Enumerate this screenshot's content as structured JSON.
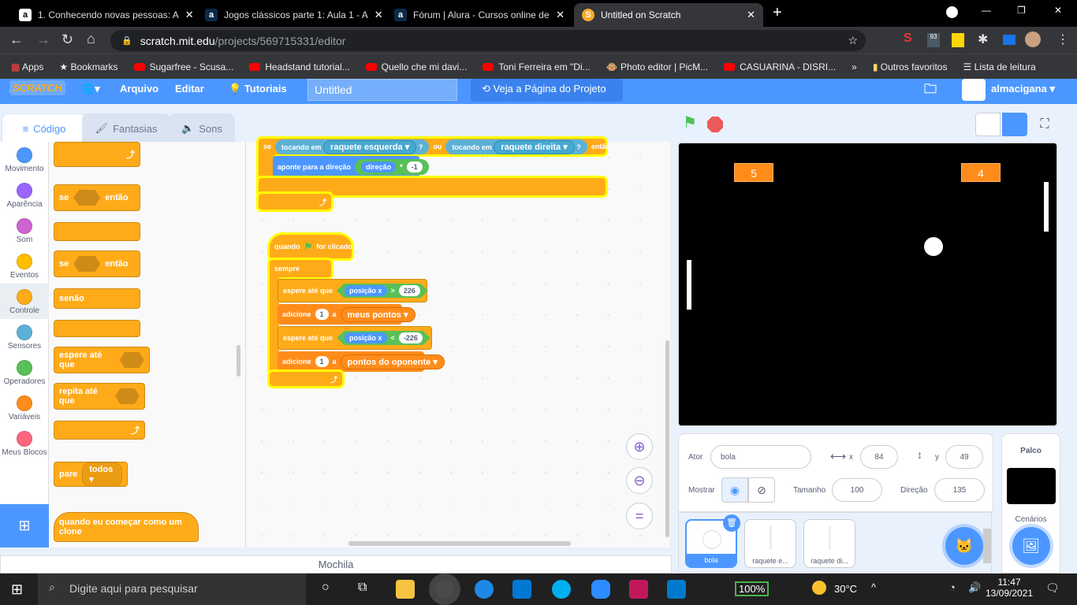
{
  "browser": {
    "tabs": [
      {
        "title": "1. Conhecendo novas pessoas: A",
        "icon": "alura-icon"
      },
      {
        "title": "Jogos clássicos parte 1: Aula 1 - A",
        "icon": "alura-icon"
      },
      {
        "title": "Fórum | Alura - Cursos online de",
        "icon": "alura-icon"
      },
      {
        "title": "Untitled on Scratch",
        "icon": "scratch-icon",
        "active": true
      }
    ],
    "url_host": "scratch.mit.edu",
    "url_path": "/projects/569715331/editor",
    "bookmarks": [
      "Apps",
      "Bookmarks",
      "Sugarfree - Scusa...",
      "Headstand tutorial...",
      "Quello che mi davi...",
      "Toni Ferreira em \"Di...",
      "Photo editor | PicM...",
      "CASUARINA - DISRI..."
    ],
    "bookmarks_overflow": "»",
    "other_bookmarks": "Outros favoritos",
    "reading_list": "Lista de leitura",
    "ext_badge": "93"
  },
  "menu": {
    "logo": "SCRATCH",
    "file": "Arquivo",
    "edit": "Editar",
    "tutorials": "Tutoriais",
    "project_title": "Untitled",
    "see_project": "Veja a Página do Projeto",
    "username": "almacigana"
  },
  "editor_tabs": [
    "Código",
    "Fantasias",
    "Sons"
  ],
  "categories": [
    {
      "label": "Movimento",
      "color": "#4c97ff"
    },
    {
      "label": "Aparência",
      "color": "#9966ff"
    },
    {
      "label": "Som",
      "color": "#cf63cf"
    },
    {
      "label": "Eventos",
      "color": "#ffbf00"
    },
    {
      "label": "Controle",
      "color": "#ffab19"
    },
    {
      "label": "Sensores",
      "color": "#5cb1d6"
    },
    {
      "label": "Operadores",
      "color": "#59c059"
    },
    {
      "label": "Variáveis",
      "color": "#ff8c1a"
    },
    {
      "label": "Meus Blocos",
      "color": "#ff6680"
    }
  ],
  "palette": {
    "if": "se",
    "then": "então",
    "else": "senão",
    "wait_until": "espere até que",
    "repeat_until": "repita até que",
    "stop": "pare",
    "stop_opt": "todos",
    "clone": "quando eu começar como um clone"
  },
  "scripts": {
    "top": {
      "if": "se",
      "touching": "tocando em",
      "left": "raquete esquerda",
      "or": "ou",
      "right": "raquete direita",
      "q": "?",
      "then": "então",
      "point": "aponte  para a direção",
      "dir": "direção",
      "times": "*",
      "val": "-1"
    },
    "main": {
      "hat": "quando",
      "hat2": "for clicado",
      "forever": "sempre",
      "wait1": "espere até que",
      "xpos": "posição x",
      "gt": ">",
      "v1": "226",
      "add": "adicione",
      "one": "1",
      "a": "a",
      "var1": "meus pontos",
      "wait2": "espere até que",
      "lt": "<",
      "v2": "-226",
      "var2": "pontos do oponente"
    }
  },
  "stage": {
    "score_left": "5",
    "score_right": "4"
  },
  "sprite_info": {
    "actor_label": "Ator",
    "actor": "bola",
    "x_label": "x",
    "x": "84",
    "y_label": "y",
    "y": "49",
    "show_label": "Mostrar",
    "size_label": "Tamanho",
    "size": "100",
    "dir_label": "Direção",
    "direction": "135"
  },
  "sprites": [
    {
      "name": "bola",
      "selected": true
    },
    {
      "name": "raquete e..."
    },
    {
      "name": "raquete di..."
    }
  ],
  "stage_pane": {
    "title": "Palco",
    "backdrops": "Cenários"
  },
  "backpack": "Mochila",
  "taskbar": {
    "search": "Digite aqui para pesquisar",
    "battery": "100%",
    "temp": "30°C",
    "time": "11:47",
    "date": "13/09/2021"
  }
}
